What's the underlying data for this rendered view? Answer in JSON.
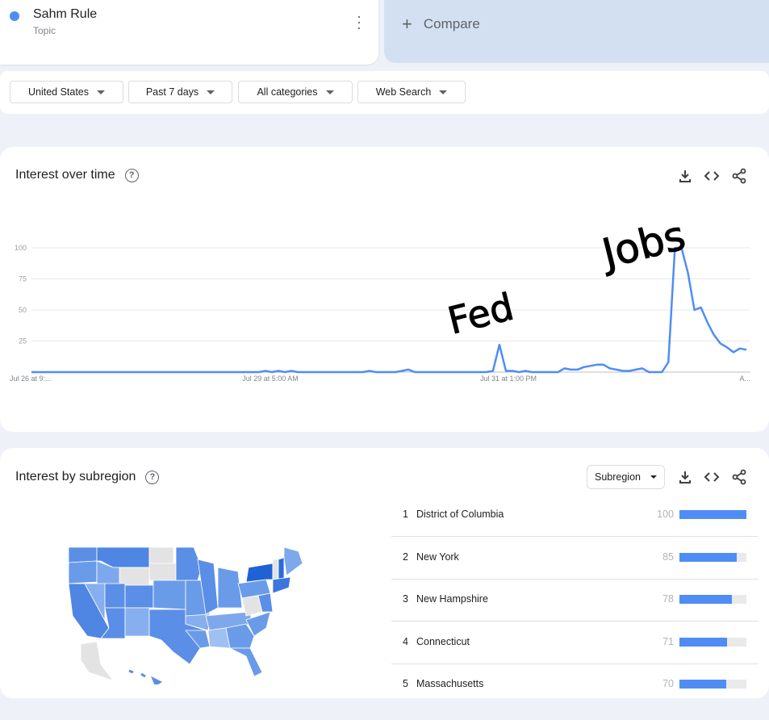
{
  "term": {
    "title": "Sahm Rule",
    "subtitle": "Topic",
    "color": "#4f8df5",
    "menu_icon": "more-vert-icon"
  },
  "compare": {
    "label": "Compare",
    "icon": "plus-icon"
  },
  "filters": [
    {
      "label": "United States"
    },
    {
      "label": "Past 7 days"
    },
    {
      "label": "All categories"
    },
    {
      "label": "Web Search"
    }
  ],
  "interest_over_time": {
    "title": "Interest over time",
    "icons": [
      "download-icon",
      "embed-icon",
      "share-icon"
    ],
    "annotations": [
      "Fed",
      "Jobs"
    ]
  },
  "chart_data": {
    "type": "line",
    "x_tick_labels": [
      "Jul 26 at 9:...",
      "Jul 29 at 5:00 AM",
      "Jul 31 at 1:00 PM",
      "A..."
    ],
    "y_ticks": [
      25,
      50,
      75,
      100
    ],
    "ylim": [
      0,
      100
    ],
    "grid": true,
    "color": "#4f8df5",
    "series": [
      {
        "values": [
          0,
          0,
          0,
          0,
          0,
          0,
          0,
          0,
          0,
          0,
          0,
          0,
          0,
          0,
          0,
          0,
          0,
          0,
          0,
          0,
          0,
          0,
          0,
          0,
          0,
          0,
          0,
          0,
          0,
          0,
          0,
          0,
          0,
          0,
          0,
          0,
          1,
          0,
          1,
          0,
          1,
          0,
          0,
          0,
          0,
          0,
          0,
          0,
          0,
          0,
          0,
          0,
          1,
          0,
          0,
          0,
          0,
          1,
          2,
          0,
          0,
          0,
          0,
          0,
          0,
          0,
          0,
          0,
          0,
          0,
          0,
          1,
          22,
          1,
          1,
          0,
          1,
          0,
          0,
          0,
          0,
          0,
          3,
          2,
          2,
          4,
          5,
          6,
          6,
          3,
          2,
          1,
          1,
          2,
          3,
          0,
          0,
          0,
          8,
          100,
          100,
          80,
          50,
          52,
          40,
          30,
          23,
          20,
          16,
          19,
          18
        ]
      }
    ]
  },
  "subregion": {
    "title": "Interest by subregion",
    "selector": "Subregion",
    "icons": [
      "download-icon",
      "embed-icon",
      "share-icon"
    ],
    "items": [
      {
        "rank": "1",
        "name": "District of Columbia",
        "value": 100
      },
      {
        "rank": "2",
        "name": "New York",
        "value": 85
      },
      {
        "rank": "3",
        "name": "New Hampshire",
        "value": 78
      },
      {
        "rank": "4",
        "name": "Connecticut",
        "value": 71
      },
      {
        "rank": "5",
        "name": "Massachusetts",
        "value": 70
      }
    ]
  }
}
